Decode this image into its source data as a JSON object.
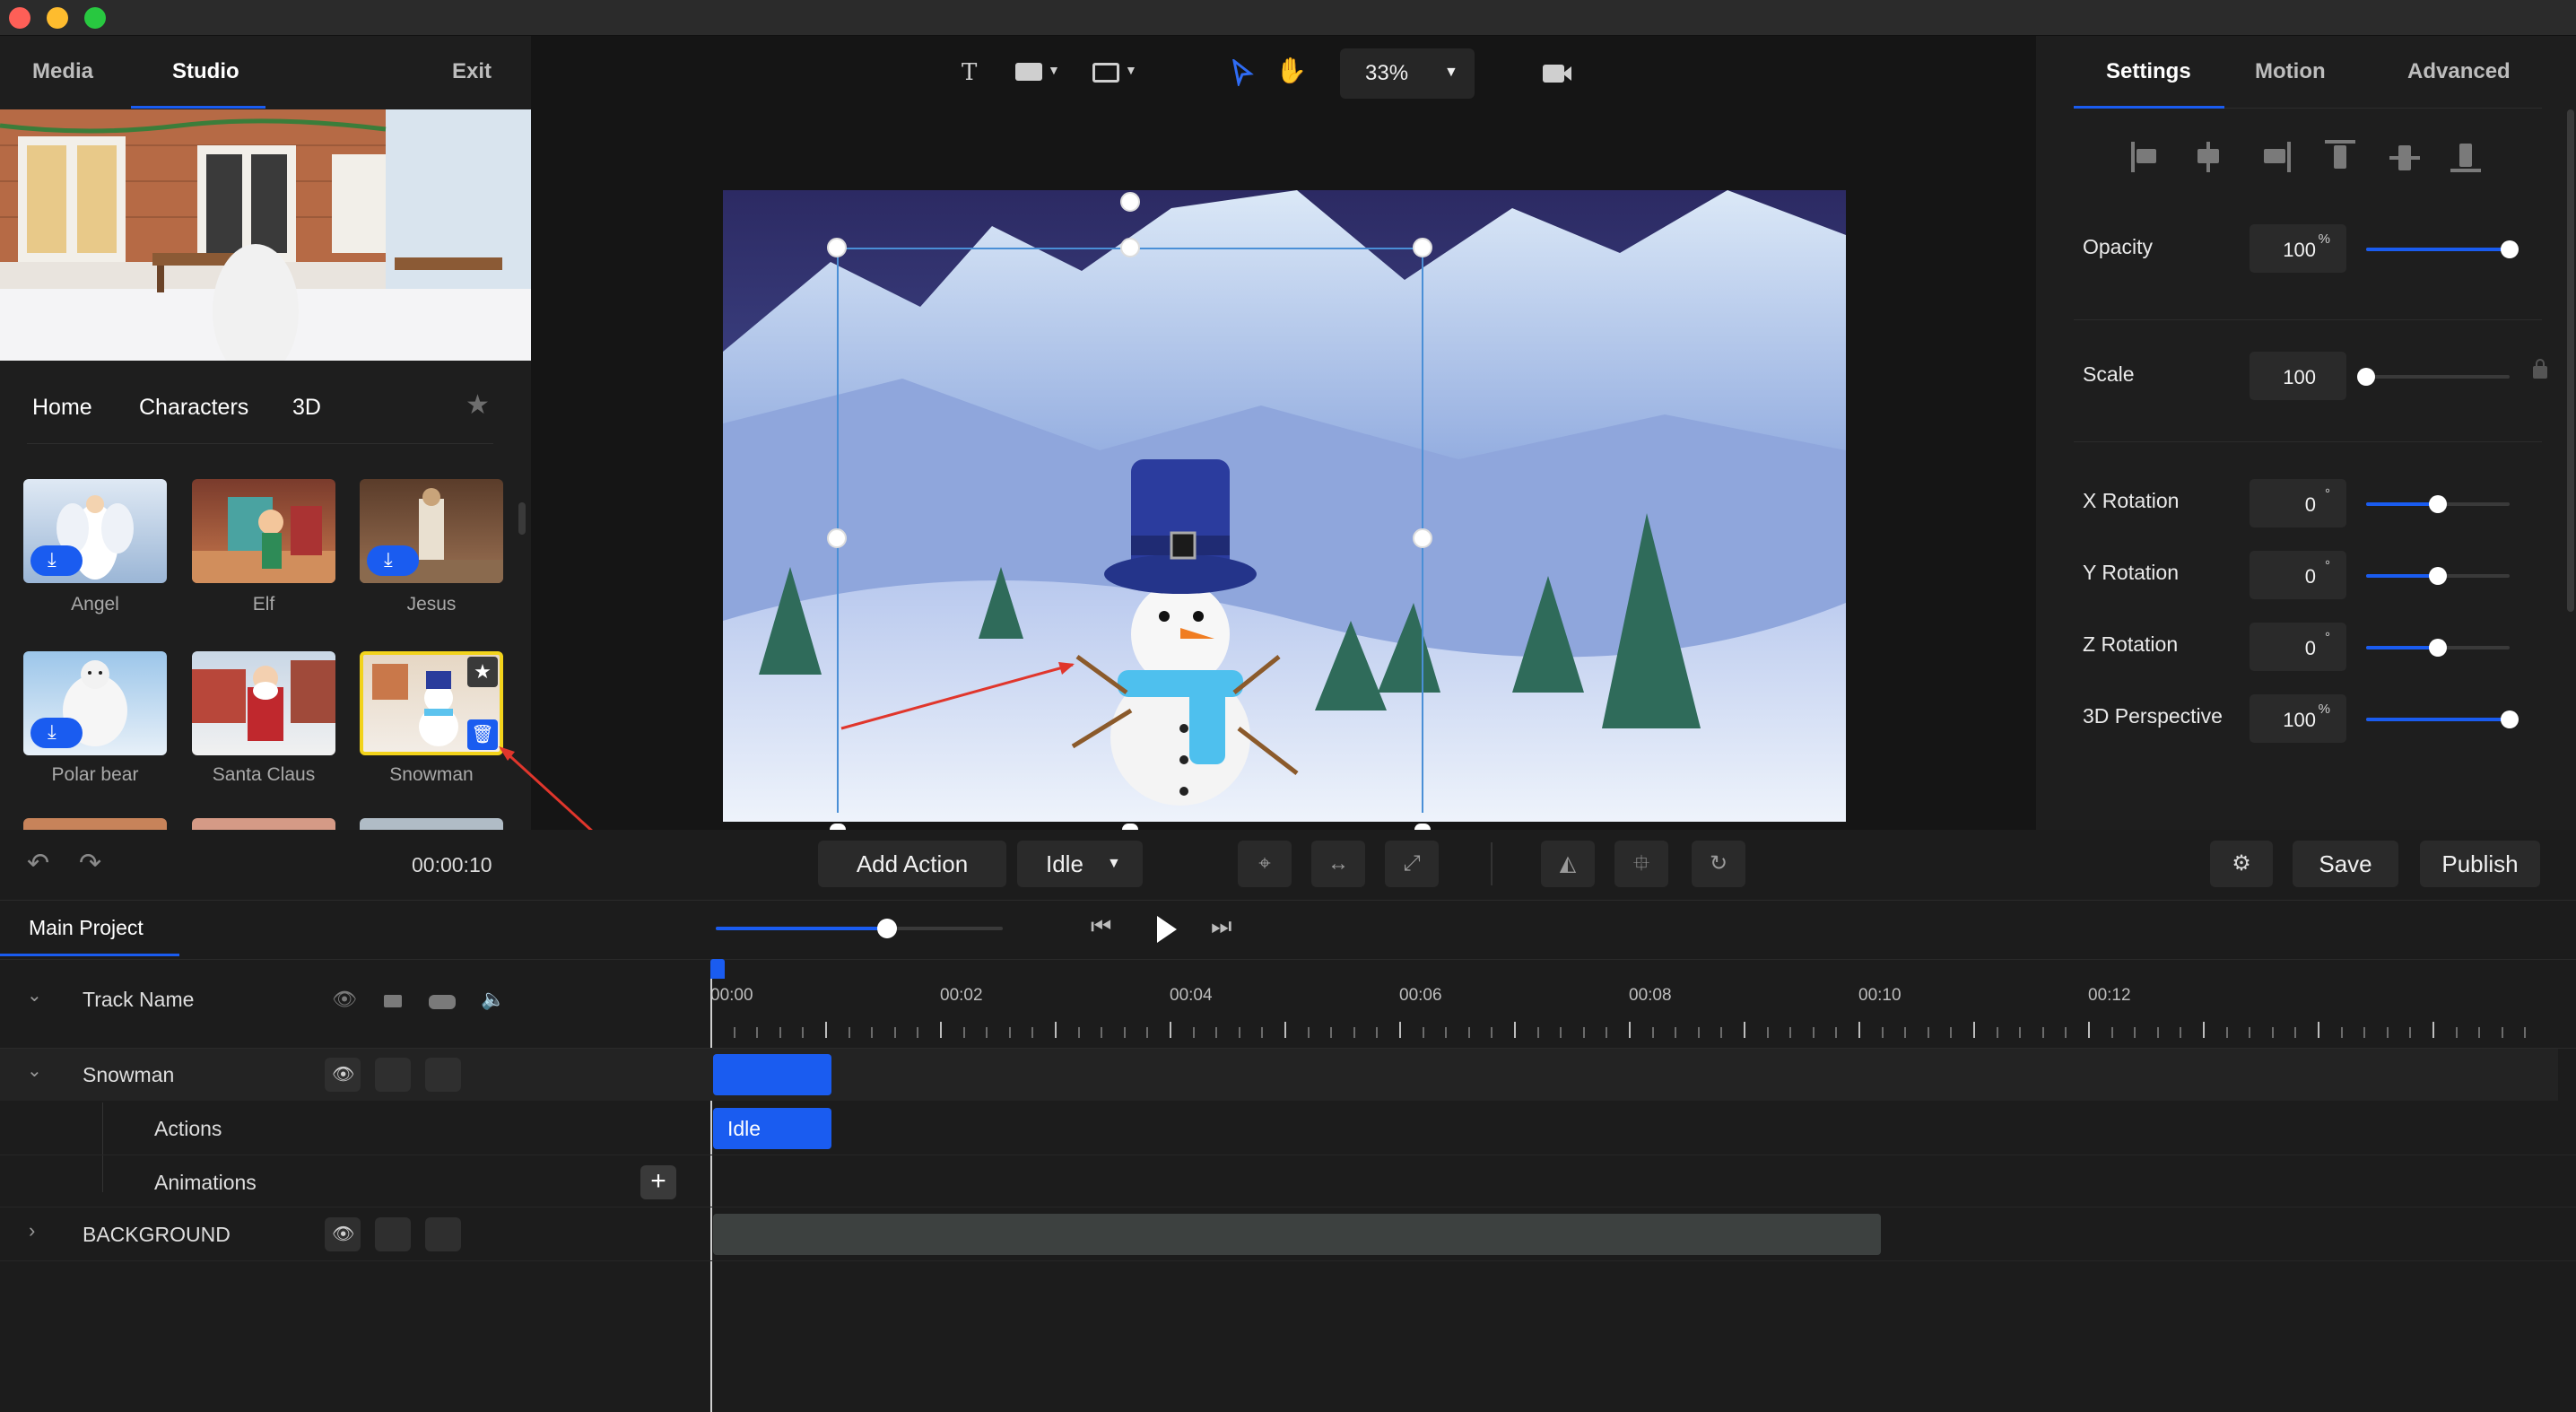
{
  "left_panel": {
    "tabs": [
      "Media",
      "Studio",
      "Exit"
    ],
    "active_tab": "Studio",
    "library_tabs": [
      "Home",
      "Characters",
      "3D"
    ],
    "items": [
      {
        "label": "Angel",
        "downloadable": true
      },
      {
        "label": "Elf",
        "downloadable": false
      },
      {
        "label": "Jesus",
        "downloadable": true
      },
      {
        "label": "Polar bear",
        "downloadable": true
      },
      {
        "label": "Santa Claus",
        "downloadable": false
      },
      {
        "label": "Snowman",
        "downloadable": false,
        "selected": true
      }
    ]
  },
  "toolbar": {
    "zoom": "33%"
  },
  "right_panel": {
    "tabs": [
      "Settings",
      "Motion",
      "Advanced"
    ],
    "active_tab": "Settings",
    "properties": [
      {
        "label": "Opacity",
        "value": "100",
        "unit": "%",
        "level": 1.0
      },
      {
        "label": "Scale",
        "value": "100",
        "unit": "",
        "level": 0.0
      },
      {
        "label": "X Rotation",
        "value": "0",
        "unit": "°",
        "level": 0.5
      },
      {
        "label": "Y Rotation",
        "value": "0",
        "unit": "°",
        "level": 0.5
      },
      {
        "label": "Z Rotation",
        "value": "0",
        "unit": "°",
        "level": 0.5
      },
      {
        "label": "3D Perspective",
        "value": "100",
        "unit": "%",
        "level": 1.0
      }
    ]
  },
  "controls": {
    "time": "00:00:10",
    "add_action": "Add Action",
    "action_select": "Idle",
    "save": "Save",
    "publish": "Publish"
  },
  "timeline": {
    "project_tab": "Main Project",
    "header": "Track Name",
    "time_labels": [
      "00:00",
      "00:02",
      "00:04",
      "00:06",
      "00:08",
      "00:10",
      "00:12"
    ],
    "tracks": [
      {
        "name": "Snowman"
      },
      {
        "name": "Actions"
      },
      {
        "name": "Animations"
      },
      {
        "name": "BACKGROUND"
      }
    ],
    "clip_label": "Idle"
  },
  "colors": {
    "accent": "#1a5cf0",
    "panel": "#1e1e1e",
    "canvas_bg": "#151515"
  }
}
